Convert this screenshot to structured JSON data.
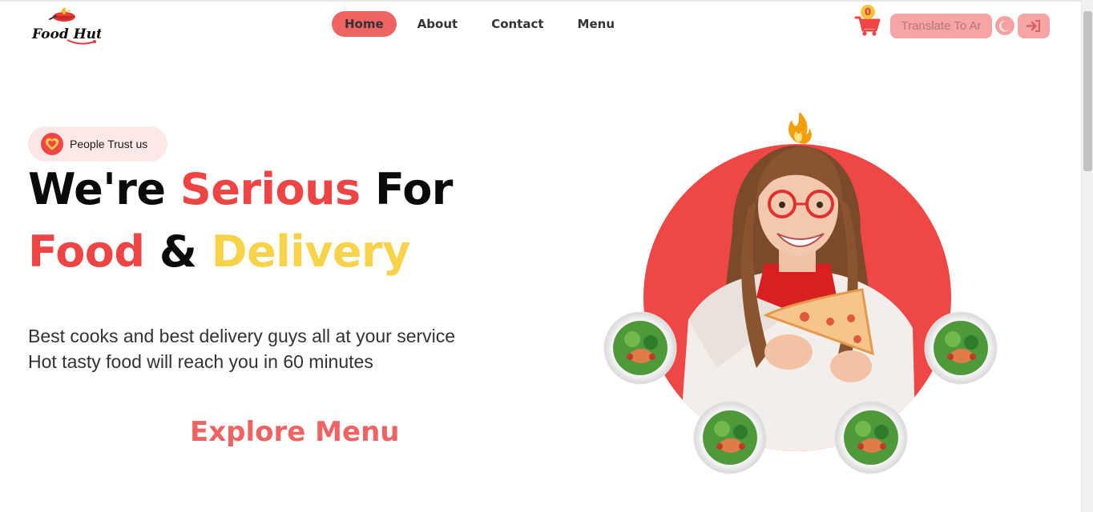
{
  "header": {
    "logo_text": "Food Hut",
    "nav": [
      {
        "label": "Home",
        "active": true
      },
      {
        "label": "About",
        "active": false
      },
      {
        "label": "Contact",
        "active": false
      },
      {
        "label": "Menu",
        "active": false
      }
    ],
    "cart_count": "0",
    "translate_label": "Translate To Ar",
    "icons": {
      "cart": "cart-icon",
      "dark_mode": "moon-icon",
      "login": "sign-in-icon"
    }
  },
  "hero": {
    "badge_text": "People Trust us",
    "badge_icon": "heart-icon",
    "headline": {
      "line1": [
        {
          "text": "We're ",
          "color": "black"
        },
        {
          "text": "Serious",
          "color": "red"
        },
        {
          "text": " For",
          "color": "black"
        }
      ],
      "line2": [
        {
          "text": "Food",
          "color": "red"
        },
        {
          "text": " & ",
          "color": "black"
        },
        {
          "text": "Delivery",
          "color": "yellow"
        }
      ]
    },
    "description_line1": "Best cooks and best delivery guys all at your service",
    "description_line2": "Hot tasty food will reach you in 60 minutes",
    "cta": "Explore Menu"
  },
  "colors": {
    "accent_red": "#ee4444",
    "accent_yellow": "#f8d34a",
    "nav_active": "#f06363",
    "button_pink": "#f7a4a4"
  }
}
